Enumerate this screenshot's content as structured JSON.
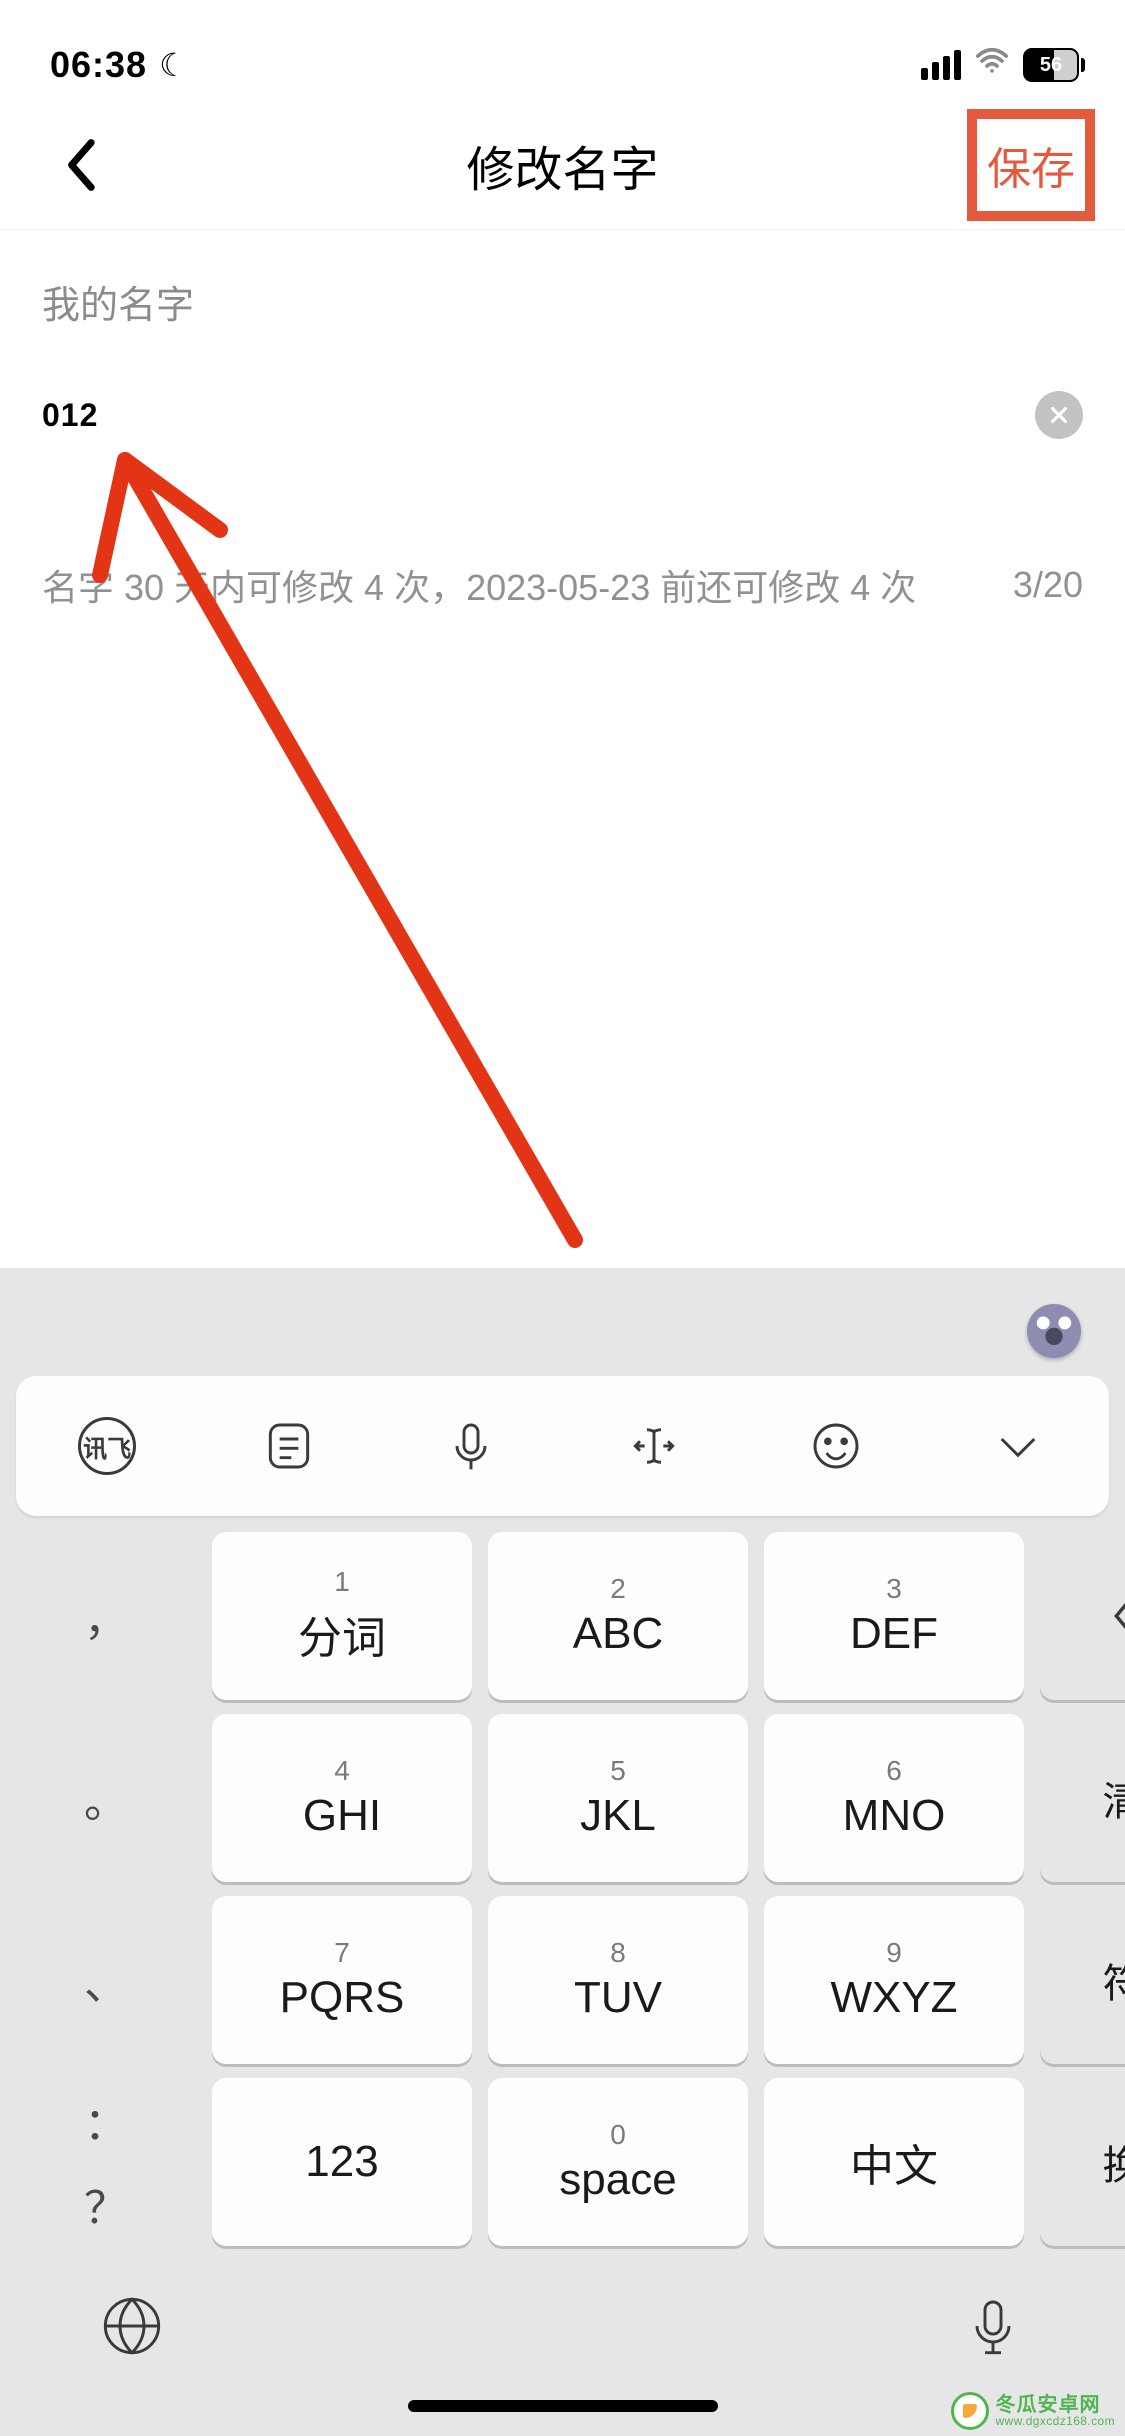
{
  "status": {
    "time": "06:38",
    "moon": "☾",
    "battery": "56"
  },
  "nav": {
    "title": "修改名字",
    "save": "保存"
  },
  "form": {
    "label": "我的名字",
    "value": "012",
    "hint": "名字 30 天内可修改 4 次，2023-05-23 前还可修改 4 次",
    "counter": "3/20"
  },
  "keyboard": {
    "toolbar": {
      "ifly": "讯飞"
    },
    "side": [
      "，",
      "。",
      "、",
      "：",
      "？"
    ],
    "keys": [
      {
        "num": "1",
        "label": "分词"
      },
      {
        "num": "2",
        "label": "ABC"
      },
      {
        "num": "3",
        "label": "DEF"
      },
      {
        "num": "4",
        "label": "GHI"
      },
      {
        "num": "5",
        "label": "JKL"
      },
      {
        "num": "6",
        "label": "MNO"
      },
      {
        "num": "7",
        "label": "PQRS"
      },
      {
        "num": "8",
        "label": "TUV"
      },
      {
        "num": "9",
        "label": "WXYZ"
      }
    ],
    "actions": {
      "clear": "清除",
      "symbols": "符号",
      "enter": "换行"
    },
    "bottom": {
      "num": "123",
      "space_num": "0",
      "space": "space",
      "lang": "中文"
    }
  },
  "watermark": {
    "name": "冬瓜安卓网",
    "url": "www.dgxcdz168.com"
  }
}
